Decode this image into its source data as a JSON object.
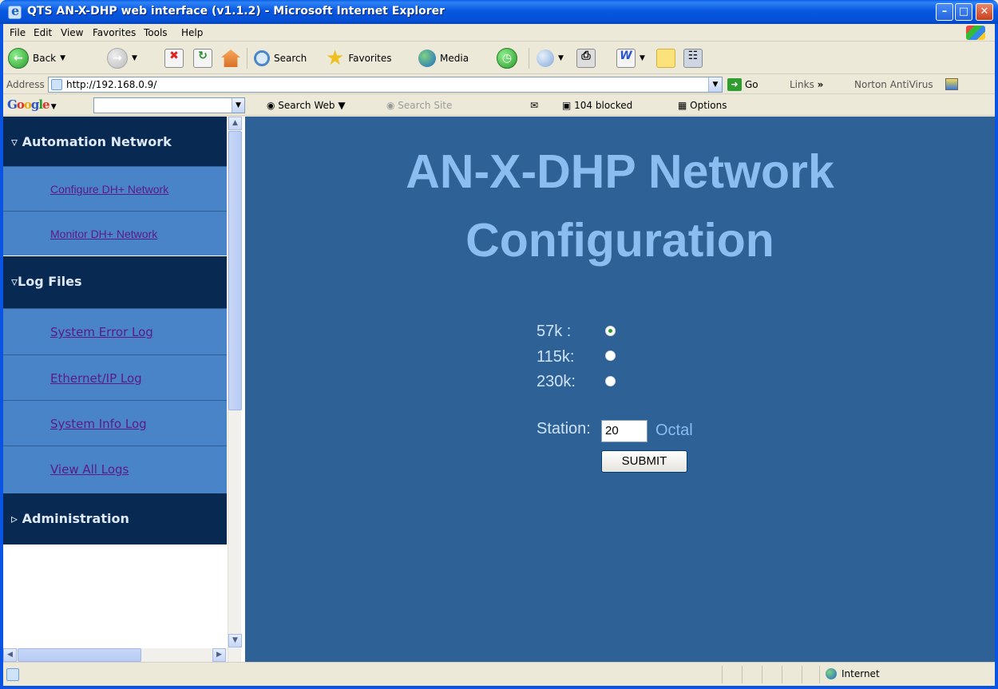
{
  "window": {
    "title": "QTS AN-X-DHP web interface (v1.1.2) - Microsoft Internet Explorer",
    "buttons": {
      "minimize": "–",
      "maximize": "□",
      "close": "✕"
    }
  },
  "menu": [
    "File",
    "Edit",
    "View",
    "Favorites",
    "Tools",
    "Help"
  ],
  "toolbar": {
    "back": "Back",
    "search": "Search",
    "favorites": "Favorites",
    "media": "Media"
  },
  "address": {
    "label": "Address",
    "url": "http://192.168.0.9/",
    "go": "Go",
    "links": "Links",
    "links_chevron": "»",
    "norton": "Norton AntiVirus"
  },
  "google_bar": {
    "logo": "Google",
    "search_web": "Search Web",
    "search_site": "Search Site",
    "blocked": "104 blocked",
    "options": "Options"
  },
  "sidebar": {
    "sections": [
      {
        "title": "Automation Network",
        "expanded": true,
        "links": [
          "Configure DH+ Network",
          "Monitor DH+ Network"
        ]
      },
      {
        "title": "Log Files",
        "expanded": true,
        "links": [
          "System Error Log",
          "Ethernet/IP Log",
          "System Info Log",
          "View All Logs"
        ]
      },
      {
        "title": "Administration",
        "expanded": false,
        "links": []
      }
    ]
  },
  "main": {
    "heading_line1": "AN-X-DHP Network",
    "heading_line2": "Configuration",
    "baud_options": [
      {
        "label": "57k :",
        "selected": true
      },
      {
        "label": "115k:",
        "selected": false
      },
      {
        "label": "230k:",
        "selected": false
      }
    ],
    "station_label": "Station:",
    "station_value": "20",
    "station_unit": "Octal",
    "submit": "SUBMIT"
  },
  "status": {
    "zone": "Internet"
  },
  "colors": {
    "main_bg": "#2e6297",
    "heading": "#8bbdf0",
    "sidebar_head": "#082a52",
    "sidebar_link_bg": "#4a84c8"
  }
}
